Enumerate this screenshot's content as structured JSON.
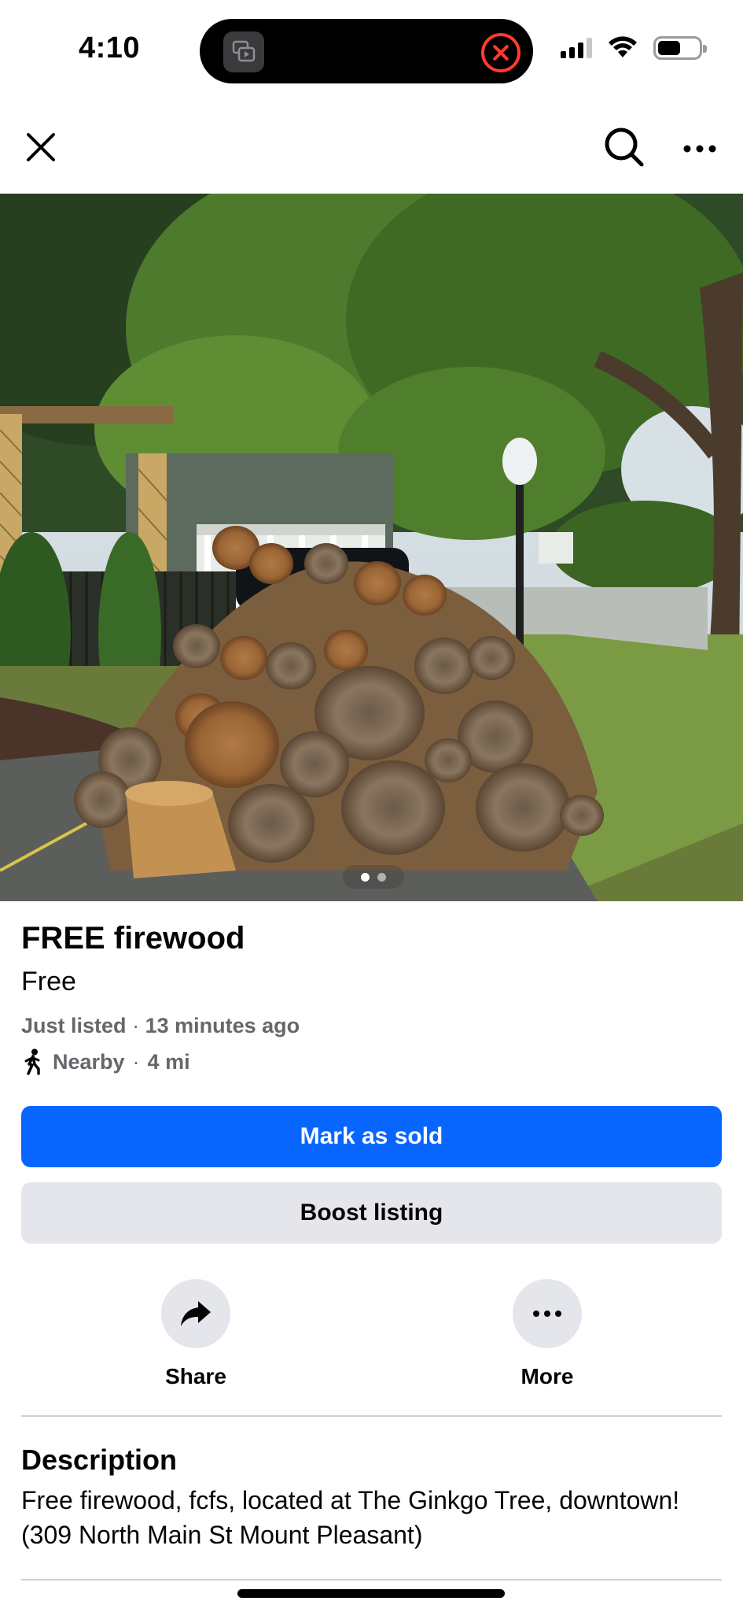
{
  "status_bar": {
    "time": "4:10",
    "icons": [
      "screen-recording-icon",
      "stop-recording-icon",
      "cellular-signal-icon",
      "wifi-icon",
      "battery-icon"
    ],
    "battery_level": 0.55
  },
  "nav": {
    "icons": [
      "close-icon",
      "search-icon",
      "more-horizontal-icon"
    ]
  },
  "photo": {
    "total_images": 2,
    "current_index": 1
  },
  "listing": {
    "title": "FREE firewood",
    "price": "Free",
    "listed": "Just listed",
    "separator": "·",
    "listed_time": "13 minutes ago",
    "nearby_label": "Nearby",
    "distance": "4 mi"
  },
  "buttons": {
    "mark_sold": "Mark as sold",
    "boost": "Boost listing"
  },
  "actions": {
    "share": "Share",
    "more": "More"
  },
  "description": {
    "heading": "Description",
    "text": "Free firewood, fcfs, located at The Ginkgo Tree, downtown! (309 North Main St Mount Pleasant)"
  },
  "colors": {
    "primary": "#0866ff",
    "secondary_bg": "#e4e6eb",
    "meta_text": "#65676b",
    "divider": "#ced0d4"
  }
}
